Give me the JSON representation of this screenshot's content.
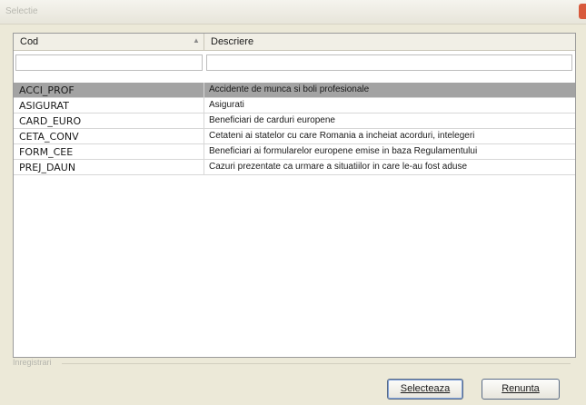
{
  "window": {
    "title": "Selectie"
  },
  "table": {
    "columns": [
      {
        "label": "Cod"
      },
      {
        "label": "Descriere"
      }
    ],
    "rows": [
      {
        "cod": "ACCI_PROF",
        "descriere": "Accidente de munca si boli profesionale",
        "selected": true
      },
      {
        "cod": "ASIGURAT",
        "descriere": "Asigurati",
        "selected": false
      },
      {
        "cod": "CARD_EURO",
        "descriere": "Beneficiari de carduri europene",
        "selected": false
      },
      {
        "cod": "CETA_CONV",
        "descriere": "Cetateni ai statelor cu care Romania a incheiat acorduri, intelegeri",
        "selected": false
      },
      {
        "cod": "FORM_CEE",
        "descriere": "Beneficiari ai formularelor europene emise in baza Regulamentului",
        "selected": false
      },
      {
        "cod": "PREJ_DAUN",
        "descriere": "Cazuri prezentate ca urmare a situatiilor in care le-au fost aduse",
        "selected": false
      }
    ]
  },
  "status": {
    "text": "Inregistrari"
  },
  "buttons": {
    "select_label": "Selecteaza",
    "cancel_label": "Renunta"
  },
  "colors": {
    "selected_row": "#a3a3a3",
    "close_button": "#d85a3c",
    "dialog_bg": "#ece9d8"
  }
}
